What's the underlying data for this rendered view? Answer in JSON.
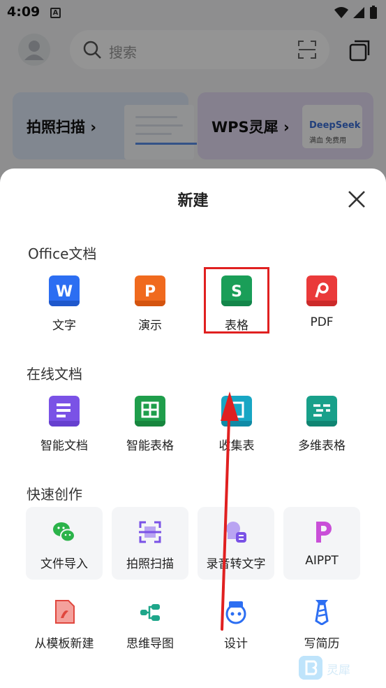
{
  "status_bar": {
    "time": "4:09",
    "notification_glyph": "A"
  },
  "home": {
    "search_placeholder": "搜索",
    "cards": [
      {
        "title": "拍照扫描",
        "chevron": "›"
      },
      {
        "title": "WPS灵犀",
        "chevron": "›",
        "badge_name": "DeepSeek",
        "badge_sub": "满血 免费用"
      }
    ]
  },
  "sheet": {
    "title": "新建",
    "sections": {
      "office": {
        "title": "Office文档",
        "items": [
          {
            "label": "文字",
            "icon": "wps-writer-icon",
            "glyph": "W",
            "color": "#2c6ef2"
          },
          {
            "label": "演示",
            "icon": "wps-presentation-icon",
            "glyph": "P",
            "color": "#f06a1e"
          },
          {
            "label": "表格",
            "icon": "wps-spreadsheet-icon",
            "glyph": "S",
            "color": "#1a9e58"
          },
          {
            "label": "PDF",
            "icon": "wps-pdf-icon",
            "glyph": "P",
            "color": "#ea3a3a"
          }
        ]
      },
      "online": {
        "title": "在线文档",
        "items": [
          {
            "label": "智能文档",
            "icon": "smart-doc-icon",
            "color": "#7a52e6"
          },
          {
            "label": "智能表格",
            "icon": "smart-sheet-icon",
            "color": "#1f9e4b"
          },
          {
            "label": "收集表",
            "icon": "collect-form-icon",
            "color": "#18a6c4"
          },
          {
            "label": "多维表格",
            "icon": "multi-table-icon",
            "color": "#18a08a"
          }
        ]
      },
      "quick": {
        "title": "快速创作",
        "tiles": [
          {
            "label": "文件导入",
            "icon": "wechat-icon"
          },
          {
            "label": "拍照扫描",
            "icon": "photo-scan-icon"
          },
          {
            "label": "录音转文字",
            "icon": "voice-to-text-icon"
          },
          {
            "label": "AIPPT",
            "icon": "aippt-icon"
          }
        ],
        "more": [
          {
            "label": "从模板新建",
            "icon": "template-icon"
          },
          {
            "label": "思维导图",
            "icon": "mind-map-icon"
          },
          {
            "label": "设计",
            "icon": "design-icon"
          },
          {
            "label": "写简历",
            "icon": "resume-icon"
          }
        ]
      }
    }
  },
  "watermark": {
    "text": "灵犀"
  },
  "colors": {
    "annotation_red": "#e02020"
  }
}
